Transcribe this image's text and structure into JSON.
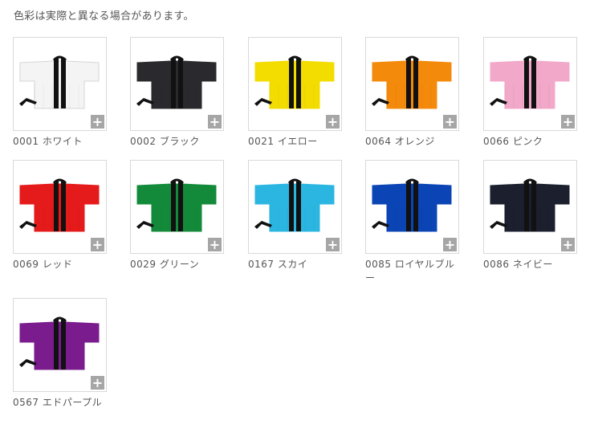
{
  "notice": "色彩は実際と異なる場合があります。",
  "swatches": [
    {
      "label": "0001 ホワイト",
      "color": "#f4f4f4"
    },
    {
      "label": "0002 ブラック",
      "color": "#2a2a2e"
    },
    {
      "label": "0021 イエロー",
      "color": "#f3dd00"
    },
    {
      "label": "0064 オレンジ",
      "color": "#f48a0c"
    },
    {
      "label": "0066 ピンク",
      "color": "#f2a8c8"
    },
    {
      "label": "0069 レッド",
      "color": "#e51a1a"
    },
    {
      "label": "0029 グリーン",
      "color": "#138a3a"
    },
    {
      "label": "0167 スカイ",
      "color": "#2bb6e2"
    },
    {
      "label": "0085 ロイヤルブルー",
      "color": "#0b45b5"
    },
    {
      "label": "0086 ネイビー",
      "color": "#1b1f2e"
    },
    {
      "label": "0567 エドパープル",
      "color": "#7a1c8e"
    }
  ],
  "enlarge_icon": "plus-icon",
  "enlarge_symbol": "+"
}
